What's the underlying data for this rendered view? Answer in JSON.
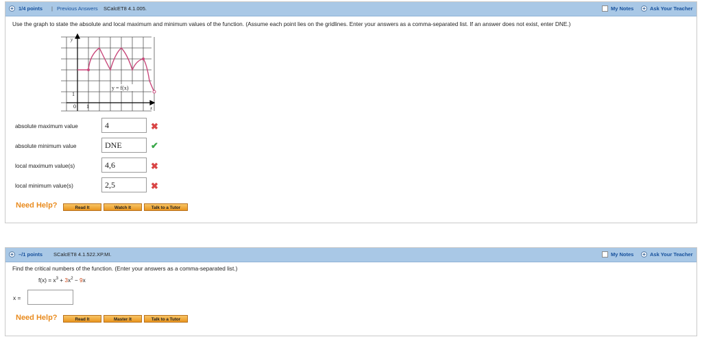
{
  "q1": {
    "points": "1/4 points",
    "separator": "|",
    "previous_answers": "Previous Answers",
    "code": "SCalcET8 4.1.005.",
    "my_notes": "My Notes",
    "ask_teacher": "Ask Your Teacher",
    "prompt": "Use the graph to state the absolute and local maximum and minimum values of the function. (Assume each point lies on the gridlines. Enter your answers as a comma-separated list. If an answer does not exist, enter DNE.)",
    "graph": {
      "y_axis_label": "y",
      "x_axis_label": "x",
      "function_label": "y = f(x)",
      "tick_1_y": "1",
      "tick_0": "0",
      "tick_1_x": "1"
    },
    "rows": [
      {
        "label": "absolute maximum value",
        "value": "4",
        "status": "wrong"
      },
      {
        "label": "absolute minimum value",
        "value": "DNE",
        "status": "correct"
      },
      {
        "label": "local maximum value(s)",
        "value": "4,6",
        "status": "wrong"
      },
      {
        "label": "local minimum value(s)",
        "value": "2,5",
        "status": "wrong"
      }
    ],
    "marks": {
      "wrong": "✖",
      "correct": "✔"
    },
    "need_help": "Need Help?",
    "help_buttons": [
      "Read It",
      "Watch It",
      "Talk to a Tutor"
    ]
  },
  "q2": {
    "points": "–/1 points",
    "code": "SCalcET8 4.1.522.XP.MI.",
    "my_notes": "My Notes",
    "ask_teacher": "Ask Your Teacher",
    "prompt": "Find the critical numbers of the function. (Enter your answers as a comma-separated list.)",
    "function": {
      "lhs": "f(x) = x",
      "exp1": "3",
      "plus": " + ",
      "c1": "3",
      "x2": "x",
      "exp2": "2",
      "minus": " − ",
      "c2": "9",
      "x3": "x"
    },
    "x_label": "x =",
    "x_value": "",
    "need_help": "Need Help?",
    "help_buttons": [
      "Read It",
      "Master It",
      "Talk to a Tutor"
    ]
  },
  "colors": {
    "bar": "#a9c8e6",
    "link": "#16509c",
    "wrong": "#d94545",
    "correct": "#3aa84a",
    "help": "#e98b1e",
    "curve": "#c8477a"
  }
}
